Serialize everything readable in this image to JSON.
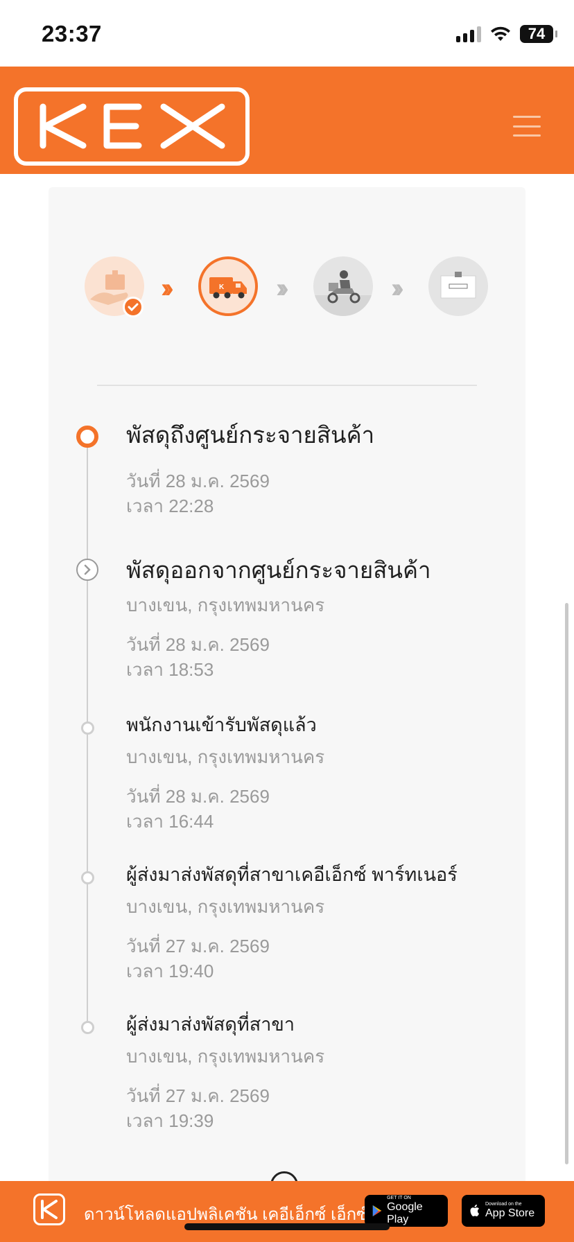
{
  "status_bar": {
    "time": "23:37",
    "battery": "74"
  },
  "header": {
    "logo_text": "KEX",
    "logo_icon": "kex-logo",
    "menu_icon": "hamburger-menu-icon",
    "brand_color": "#f4732a"
  },
  "progress": {
    "steps": [
      {
        "name": "parcel-received",
        "state": "done",
        "icon": "package-hand-icon"
      },
      {
        "name": "in-transit",
        "state": "current",
        "icon": "delivery-truck-icon"
      },
      {
        "name": "out-for-delivery",
        "state": "pending",
        "icon": "scooter-courier-icon"
      },
      {
        "name": "delivered",
        "state": "pending",
        "icon": "delivered-box-icon"
      }
    ]
  },
  "timeline": [
    {
      "title": "พัสดุถึงศูนย์กระจายสินค้า",
      "location": "",
      "date": "วันที่ 28 ม.ค. 2569",
      "time": "เวลา 22:28"
    },
    {
      "title": "พัสดุออกจากศูนย์กระจายสินค้า",
      "location": "บางเขน, กรุงเทพมหานคร",
      "date": "วันที่ 28 ม.ค. 2569",
      "time": "เวลา 18:53"
    },
    {
      "title": "พนักงานเข้ารับพัสดุแล้ว",
      "location": "บางเขน, กรุงเทพมหานคร",
      "date": "วันที่ 28 ม.ค. 2569",
      "time": "เวลา 16:44"
    },
    {
      "title": "ผู้ส่งมาส่งพัสดุที่สาขาเคอีเอ็กซ์ พาร์ทเนอร์",
      "location": "บางเขน, กรุงเทพมหานคร",
      "date": "วันที่ 27 ม.ค. 2569",
      "time": "เวลา 19:40"
    },
    {
      "title": "ผู้ส่งมาส่งพัสดุที่สาขา",
      "location": "บางเขน, กรุงเทพมหานคร",
      "date": "วันที่ 27 ม.ค. 2569",
      "time": "เวลา 19:39"
    }
  ],
  "banner": {
    "text": "ดาวน์โหลดแอปพลิเคชัน เคอีเอ็กซ์ เอ็กซ์เพรส",
    "google_small": "GET IT ON",
    "google_big": "Google Play",
    "apple_small": "Download on the",
    "apple_big": "App Store"
  }
}
